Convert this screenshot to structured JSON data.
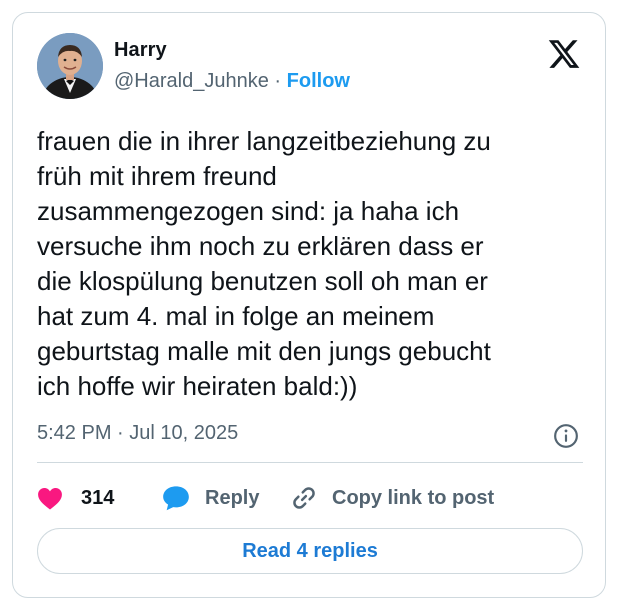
{
  "author": {
    "name": "Harry",
    "handle": "@Harald_Juhnke",
    "separator": "·",
    "follow_label": "Follow"
  },
  "platform_icon": "x-logo-icon",
  "tweet": {
    "text": "frauen die in ihrer langzeitbeziehung zu\nfrüh mit ihrem freund\nzusammengezogen sind: ja haha ich\nversuche ihm noch zu erklären dass er\ndie klospülung benutzen soll oh man er\nhat zum 4. mal in folge an meinem\ngeburtstag malle mit den jungs gebucht\nich hoffe wir heiraten bald:))",
    "timestamp": "5:42 PM · Jul 10, 2025"
  },
  "actions": {
    "like_count": "314",
    "reply_label": "Reply",
    "copy_label": "Copy link to post"
  },
  "read_replies_label": "Read 4 replies",
  "colors": {
    "accent": "#1d9bf0",
    "like": "#f91880",
    "muted": "#536471",
    "border": "#cfd9de"
  }
}
